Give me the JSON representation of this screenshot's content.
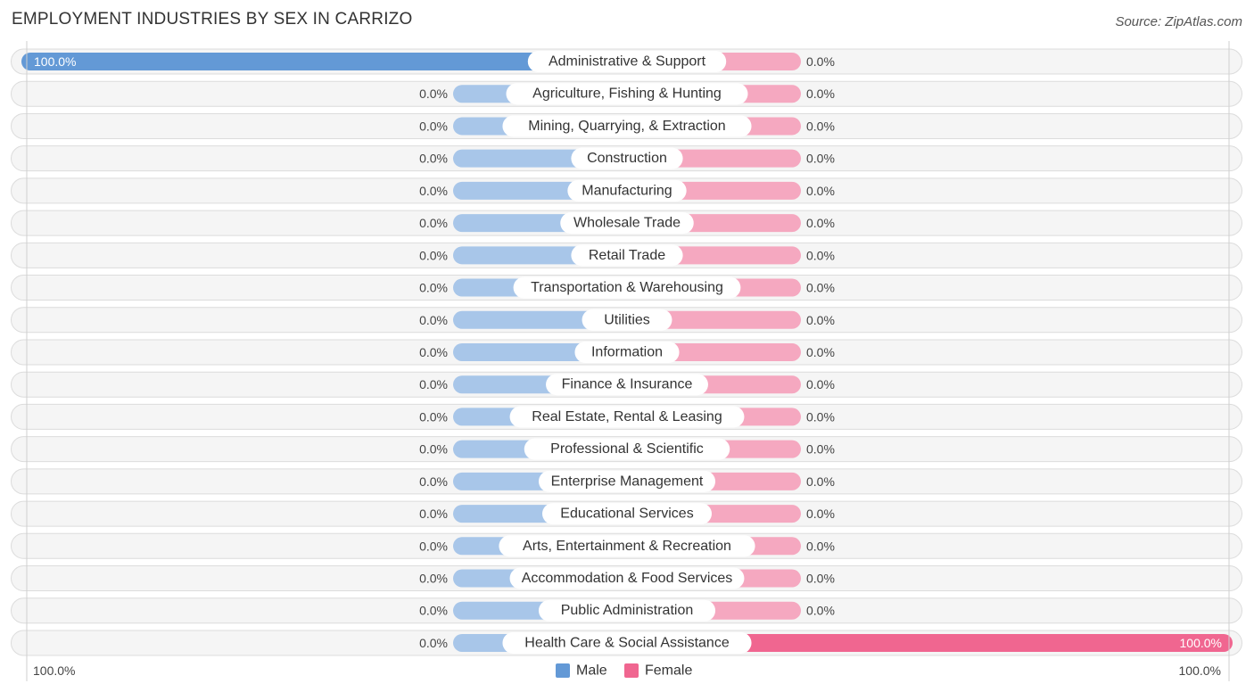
{
  "header": {
    "title": "EMPLOYMENT INDUSTRIES BY SEX IN CARRIZO",
    "source": "Source: ZipAtlas.com"
  },
  "colors": {
    "male_full": "#6399d6",
    "male_light": "#a8c6e9",
    "female_full": "#f06690",
    "female_light": "#f5a8c0",
    "row_bg": "#f5f5f5"
  },
  "chart_data": {
    "type": "bar",
    "orientation": "horizontal-diverging",
    "title": "EMPLOYMENT INDUSTRIES BY SEX IN CARRIZO",
    "categories": [
      "Administrative & Support",
      "Agriculture, Fishing & Hunting",
      "Mining, Quarrying, & Extraction",
      "Construction",
      "Manufacturing",
      "Wholesale Trade",
      "Retail Trade",
      "Transportation & Warehousing",
      "Utilities",
      "Information",
      "Finance & Insurance",
      "Real Estate, Rental & Leasing",
      "Professional & Scientific",
      "Enterprise Management",
      "Educational Services",
      "Arts, Entertainment & Recreation",
      "Accommodation & Food Services",
      "Public Administration",
      "Health Care & Social Assistance"
    ],
    "series": [
      {
        "name": "Male",
        "values": [
          100,
          0,
          0,
          0,
          0,
          0,
          0,
          0,
          0,
          0,
          0,
          0,
          0,
          0,
          0,
          0,
          0,
          0,
          0
        ]
      },
      {
        "name": "Female",
        "values": [
          0,
          0,
          0,
          0,
          0,
          0,
          0,
          0,
          0,
          0,
          0,
          0,
          0,
          0,
          0,
          0,
          0,
          0,
          100
        ]
      }
    ],
    "value_labels": {
      "male": [
        "100.0%",
        "0.0%",
        "0.0%",
        "0.0%",
        "0.0%",
        "0.0%",
        "0.0%",
        "0.0%",
        "0.0%",
        "0.0%",
        "0.0%",
        "0.0%",
        "0.0%",
        "0.0%",
        "0.0%",
        "0.0%",
        "0.0%",
        "0.0%",
        "0.0%"
      ],
      "female": [
        "0.0%",
        "0.0%",
        "0.0%",
        "0.0%",
        "0.0%",
        "0.0%",
        "0.0%",
        "0.0%",
        "0.0%",
        "0.0%",
        "0.0%",
        "0.0%",
        "0.0%",
        "0.0%",
        "0.0%",
        "0.0%",
        "0.0%",
        "0.0%",
        "100.0%"
      ]
    },
    "xlim": [
      0,
      100
    ],
    "axis_labels": {
      "left": "100.0%",
      "right": "100.0%"
    },
    "legend": {
      "position": "bottom-center",
      "entries": [
        "Male",
        "Female"
      ]
    },
    "units": "percent"
  }
}
